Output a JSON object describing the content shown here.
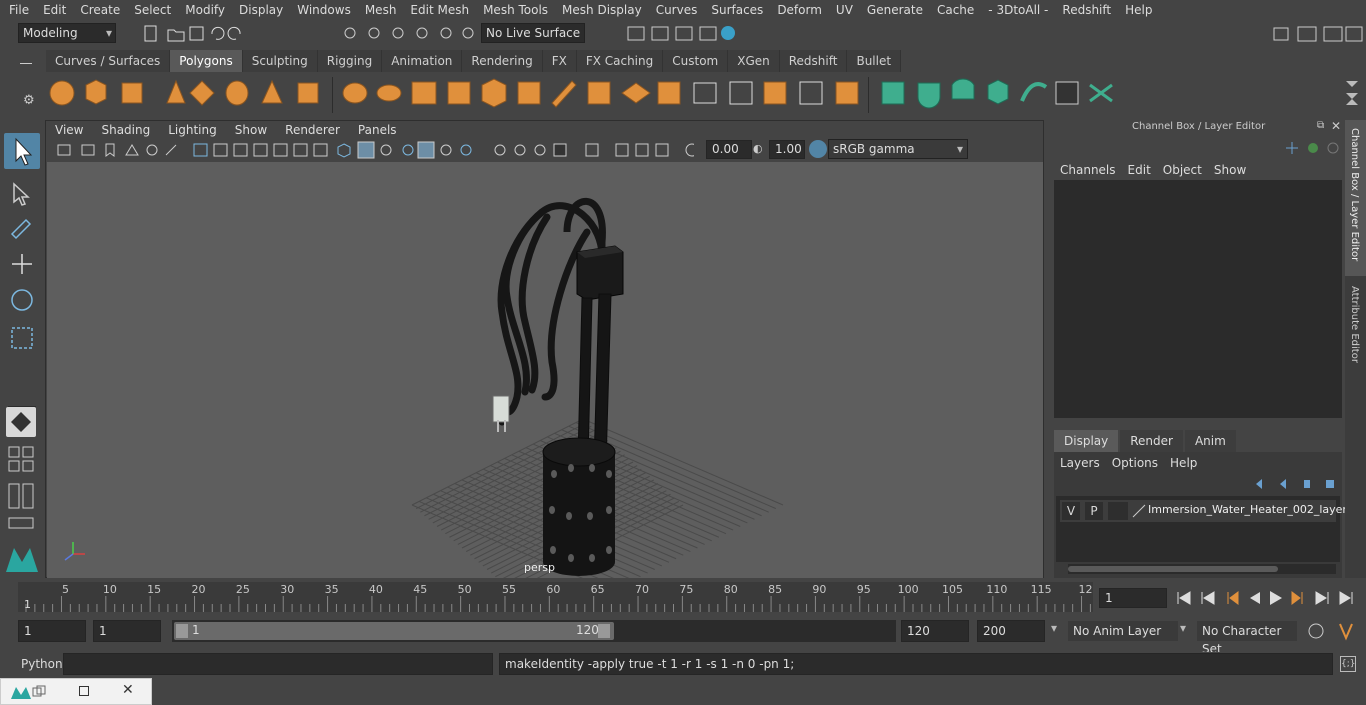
{
  "menubar": [
    "File",
    "Edit",
    "Create",
    "Select",
    "Modify",
    "Display",
    "Windows",
    "Mesh",
    "Edit Mesh",
    "Mesh Tools",
    "Mesh Display",
    "Curves",
    "Surfaces",
    "Deform",
    "UV",
    "Generate",
    "Cache",
    "- 3DtoAll -",
    "Redshift",
    "Help"
  ],
  "status": {
    "mode": "Modeling",
    "live_surface": "No Live Surface"
  },
  "shelf_tabs": [
    "Curves / Surfaces",
    "Polygons",
    "Sculpting",
    "Rigging",
    "Animation",
    "Rendering",
    "FX",
    "FX Caching",
    "Custom",
    "XGen",
    "Redshift",
    "Bullet"
  ],
  "shelf_active": "Polygons",
  "viewport": {
    "menu": [
      "View",
      "Shading",
      "Lighting",
      "Show",
      "Renderer",
      "Panels"
    ],
    "exposure": "0.00",
    "gamma": "1.00",
    "color_space": "sRGB gamma",
    "camera_label": "persp"
  },
  "channel_box": {
    "title": "Channel Box / Layer Editor",
    "menu": [
      "Channels",
      "Edit",
      "Object",
      "Show"
    ],
    "layer_tabs": [
      "Display",
      "Render",
      "Anim"
    ],
    "layer_tab_active": "Display",
    "layer_menu": [
      "Layers",
      "Options",
      "Help"
    ],
    "layer": {
      "v": "V",
      "p": "P",
      "name": "Immersion_Water_Heater_002_layer"
    },
    "side_tabs": [
      "Channel Box / Layer Editor",
      "Attribute Editor"
    ]
  },
  "timeline": {
    "ticks": [
      "5",
      "10",
      "15",
      "20",
      "25",
      "30",
      "35",
      "40",
      "45",
      "50",
      "55",
      "60",
      "65",
      "70",
      "75",
      "80",
      "85",
      "90",
      "95",
      "100",
      "105",
      "110",
      "115",
      "12"
    ],
    "start_label": "1",
    "current_frame": "1"
  },
  "range": {
    "start": "1",
    "inner_start": "1",
    "slider_start": "1",
    "slider_end": "120",
    "end": "120",
    "outer_end": "200",
    "anim_layer": "No Anim Layer",
    "char_set": "No Character Set"
  },
  "command": {
    "language": "Python",
    "output": "makeIdentity -apply true -t 1 -r 1 -s 1 -n 0 -pn 1;"
  },
  "colors": {
    "accent": "#5285a6",
    "shelf_orange": "#e0903c",
    "shelf_green": "#3fae8e"
  }
}
